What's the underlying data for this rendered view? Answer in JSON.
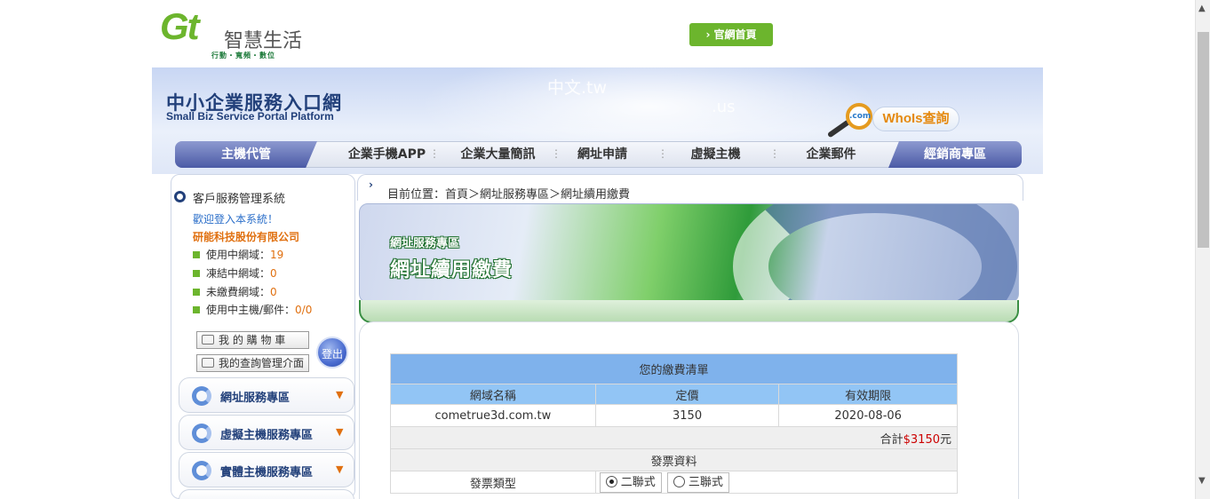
{
  "header": {
    "logo_mark": "Gt",
    "logo_name": "智慧生活",
    "logo_tagline": "行動・寬頻・數位",
    "home_button": "› 官網首頁"
  },
  "banner": {
    "title_zh": "中小企業服務入口網",
    "title_en": "Small Biz Service Portal Platform",
    "ghost_text_1": "中文.tw",
    "ghost_text_2": ".us",
    "whois_label": "WhoIs查詢",
    "whois_lens": ".com"
  },
  "nav": {
    "left": "主機代管",
    "items": [
      "企業手機APP",
      "企業大量簡訊",
      "網址申請",
      "虛擬主機",
      "企業郵件"
    ],
    "right": "經銷商專區"
  },
  "sidebar": {
    "title": "客戶服務管理系統",
    "welcome": "歡迎登入本系統！",
    "company": "研能科技股份有限公司",
    "stats": [
      {
        "label": "使用中網域：",
        "value": "19"
      },
      {
        "label": "凍結中網域：",
        "value": "0"
      },
      {
        "label": "未繳費網域：",
        "value": "0"
      },
      {
        "label": "使用中主機/郵件：",
        "value": "0/0"
      }
    ],
    "cart_button": "我 的 購 物 車",
    "query_button": "我的查詢管理介面",
    "logout_button": "登出",
    "services": [
      "網址服務專區",
      "虛擬主機服務專區",
      "實體主機服務專區"
    ]
  },
  "breadcrumb": "目前位置：首頁＞網址服務專區＞網址續用繳費",
  "hero": {
    "subtitle": "網址服務專區",
    "title": "網址續用繳費"
  },
  "bill": {
    "title": "您的繳費清單",
    "columns": [
      "網域名稱",
      "定價",
      "有效期限"
    ],
    "rows": [
      {
        "domain": "cometrue3d.com.tw",
        "price": "3150",
        "expiry": "2020-08-06"
      }
    ],
    "total_prefix": "合計",
    "total_amount": "$3150",
    "total_suffix": "元",
    "invoice_section": "發票資料",
    "invoice_type_label": "發票類型",
    "invoice_options": [
      "二聯式",
      "三聯式"
    ],
    "invoice_selected": "二聯式"
  }
}
